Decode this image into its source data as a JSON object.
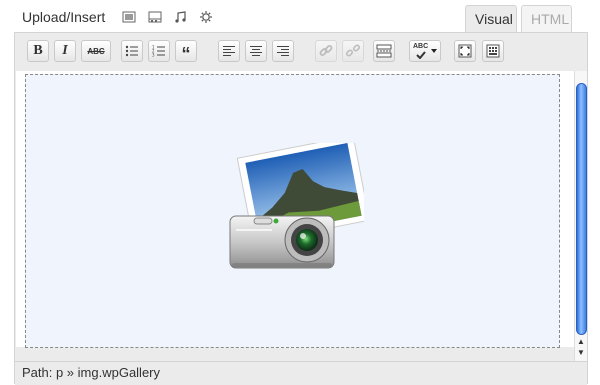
{
  "header": {
    "upload_label": "Upload/Insert",
    "media_icons": [
      "image-icon",
      "video-icon",
      "audio-icon",
      "media-icon"
    ]
  },
  "tabs": [
    {
      "label": "Visual",
      "active": true
    },
    {
      "label": "HTML",
      "active": false
    }
  ],
  "toolbar": {
    "buttons": [
      {
        "name": "bold-button",
        "glyph": "B"
      },
      {
        "name": "italic-button",
        "glyph": "I"
      },
      {
        "name": "strikethrough-button",
        "glyph": "ABC"
      },
      {
        "name": "unordered-list-button",
        "icon": "unordered-list-icon"
      },
      {
        "name": "ordered-list-button",
        "icon": "ordered-list-icon"
      },
      {
        "name": "blockquote-button",
        "glyph": "“"
      },
      {
        "name": "align-left-button",
        "icon": "align-left-icon"
      },
      {
        "name": "align-center-button",
        "icon": "align-center-icon"
      },
      {
        "name": "align-right-button",
        "icon": "align-right-icon"
      },
      {
        "name": "insert-link-button",
        "icon": "link-icon",
        "disabled": true
      },
      {
        "name": "unlink-button",
        "icon": "unlink-icon",
        "disabled": true
      },
      {
        "name": "insert-more-button",
        "icon": "more-tag-icon"
      },
      {
        "name": "spellcheck-button",
        "glyph": "ABC"
      },
      {
        "name": "fullscreen-button",
        "icon": "fullscreen-icon"
      },
      {
        "name": "kitchen-sink-button",
        "icon": "kitchen-sink-icon"
      }
    ]
  },
  "content": {
    "gallery_icon": "gallery-camera-photo-icon"
  },
  "status": {
    "path_label": "Path: p » img.wpGallery"
  },
  "colors": {
    "toolbar_bg": "#ebebeb",
    "gallery_bg": "#f0f5fd",
    "scroll_thumb": "#3b7ee3"
  }
}
